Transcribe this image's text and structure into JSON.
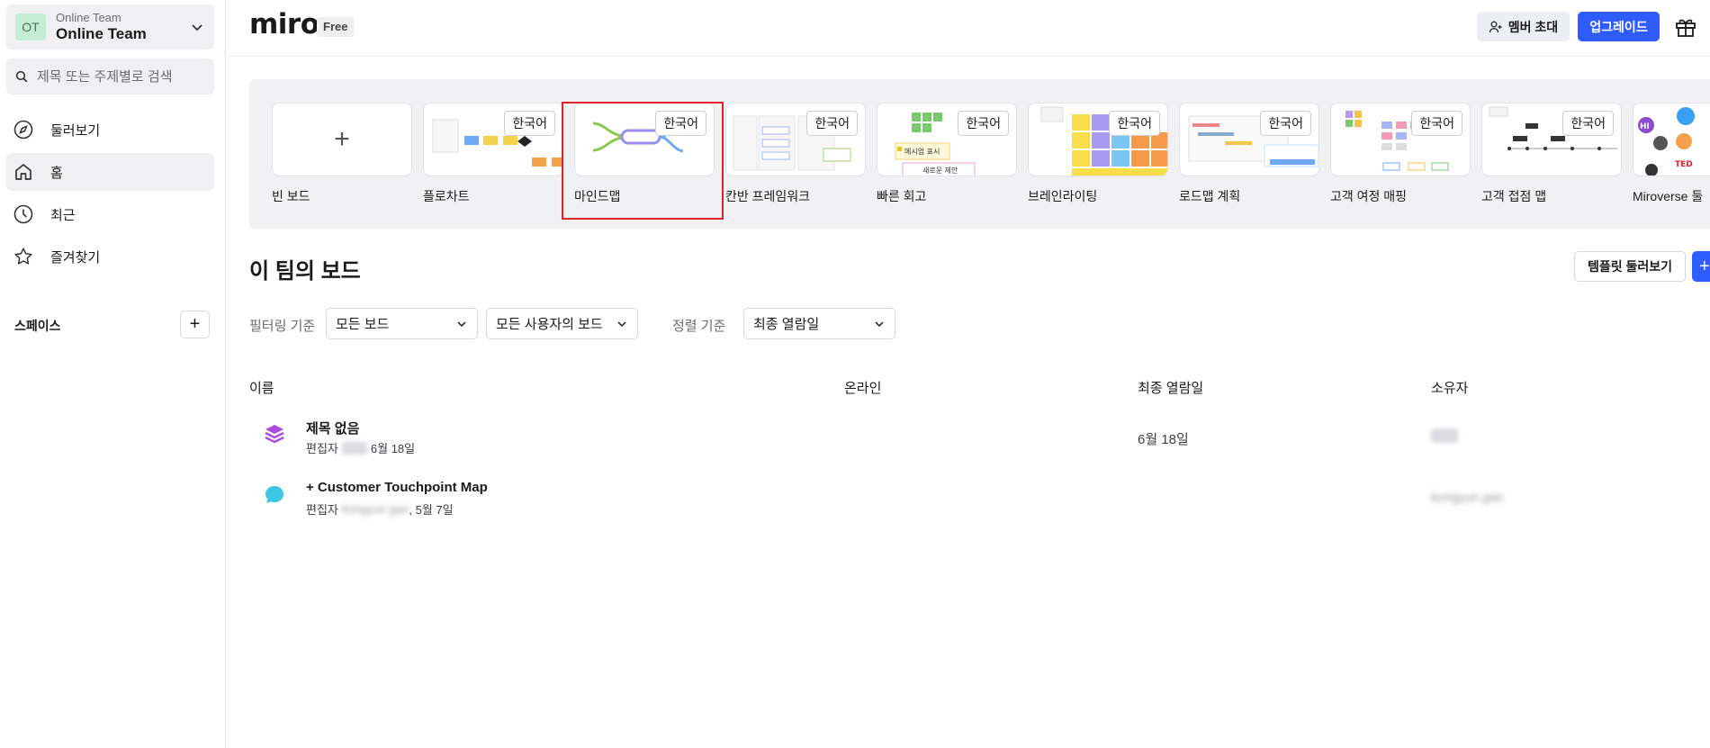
{
  "sidebar": {
    "team_avatar": "OT",
    "team_sub": "Online Team",
    "team_name": "Online Team",
    "search_placeholder": "제목 또는 주제별로 검색",
    "nav": [
      {
        "label": "둘러보기",
        "icon": "compass-icon"
      },
      {
        "label": "홈",
        "icon": "home-icon",
        "active": true
      },
      {
        "label": "최근",
        "icon": "clock-icon"
      },
      {
        "label": "즐겨찾기",
        "icon": "star-icon"
      }
    ],
    "spaces_title": "스페이스",
    "spaces_add": "+"
  },
  "header": {
    "logo": "miro",
    "plan": "Free",
    "invite_label": "멤버 초대",
    "upgrade_label": "업그레이드"
  },
  "templates": {
    "items": [
      {
        "name": "빈 보드",
        "badge": ""
      },
      {
        "name": "플로차트",
        "badge": "한국어"
      },
      {
        "name": "마인드맵",
        "badge": "한국어"
      },
      {
        "name": "칸반 프레임워크",
        "badge": "한국어"
      },
      {
        "name": "빠른 회고",
        "badge": "한국어"
      },
      {
        "name": "브레인라이팅",
        "badge": "한국어"
      },
      {
        "name": "로드맵 계획",
        "badge": "한국어"
      },
      {
        "name": "고객 여정 매핑",
        "badge": "한국어"
      },
      {
        "name": "고객 접점 맵",
        "badge": "한국어"
      },
      {
        "name": "Miroverse 둘",
        "badge": ""
      }
    ],
    "blank_plus": "+",
    "retro_card_text_1": "메시업 표시",
    "retro_card_text_2": "새로운 제안",
    "miroverse_text_1": "HI",
    "miroverse_text_2": "TED"
  },
  "boards": {
    "title": "이 팀의 보드",
    "browse_label": "템플릿 둘러보기",
    "new_label": "+",
    "filter_label": "필터링 기준",
    "filter_board": "모든 보드",
    "filter_user": "모든 사용자의 보드",
    "sort_label": "정렬 기준",
    "sort_value": "최종 열람일",
    "columns": {
      "name": "이름",
      "online": "온라인",
      "last_viewed": "최종 열람일",
      "owner": "소유자"
    },
    "rows": [
      {
        "title": "제목 없음",
        "editor_prefix": "편집자",
        "editor_suffix": "6월 18일",
        "last_viewed": "6월 18일",
        "owner": ""
      },
      {
        "title": "+ Customer Touchpoint Map",
        "editor_prefix": "편집자",
        "editor_name": "kongyun gan",
        "editor_suffix": ", 5월 7일",
        "last_viewed": "",
        "owner": "kongyun gan"
      }
    ]
  },
  "colors": {
    "accent": "#2f5bff",
    "highlight": "#e0232a"
  }
}
